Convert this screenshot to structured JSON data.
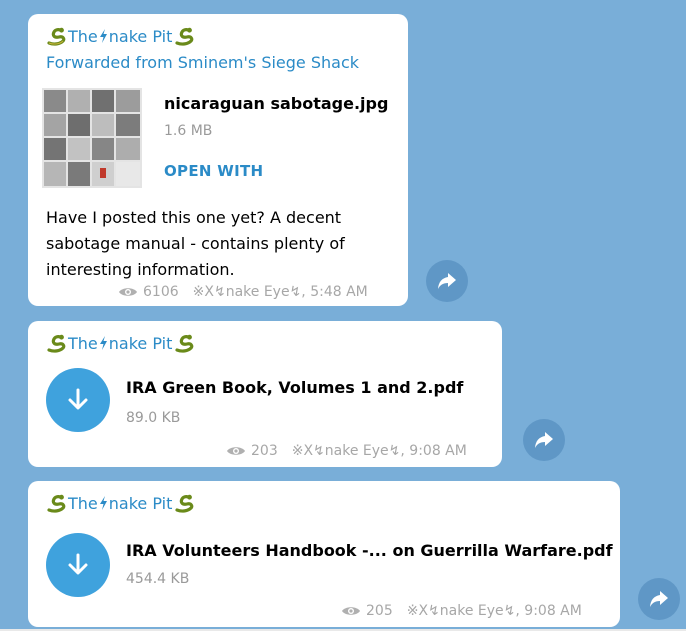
{
  "colors": {
    "chat_background": "#79aed8",
    "bubble": "#ffffff",
    "accent_blue": "#2b8bc7",
    "download_button": "#3fa2dd",
    "share_button": "#5f97c6",
    "meta_gray": "#a7a7a7"
  },
  "messages": [
    {
      "sender_prefix": "The ",
      "sender_suffix": "nake Pit",
      "forwarded_from": "Forwarded from Sminem's Siege Shack",
      "file_name": "nicaraguan sabotage.jpg",
      "file_size": "1.6 MB",
      "open_with": "OPEN WITH",
      "caption": "Have I posted this one yet? A decent sabotage manual - contains plenty of interesting information.",
      "views": "6106",
      "author": "※X↯nake Eye↯, 5:48 AM",
      "icons": [
        "snake-icon",
        "bolt-icon",
        "eye-icon",
        "share-icon"
      ]
    },
    {
      "sender_prefix": "The ",
      "sender_suffix": "nake Pit",
      "file_name": "IRA Green Book, Volumes 1 and 2.pdf",
      "file_size": "89.0 KB",
      "views": "203",
      "author": "※X↯nake Eye↯, 9:08 AM",
      "icons": [
        "snake-icon",
        "bolt-icon",
        "download-arrow-icon",
        "eye-icon",
        "share-icon"
      ]
    },
    {
      "sender_prefix": "The ",
      "sender_suffix": "nake Pit",
      "file_name": "IRA Volunteers Handbook -... on Guerrilla Warfare.pdf",
      "file_size": "454.4 KB",
      "views": "205",
      "author": "※X↯nake Eye↯, 9:08 AM",
      "icons": [
        "snake-icon",
        "bolt-icon",
        "download-arrow-icon",
        "eye-icon",
        "share-icon"
      ]
    }
  ]
}
